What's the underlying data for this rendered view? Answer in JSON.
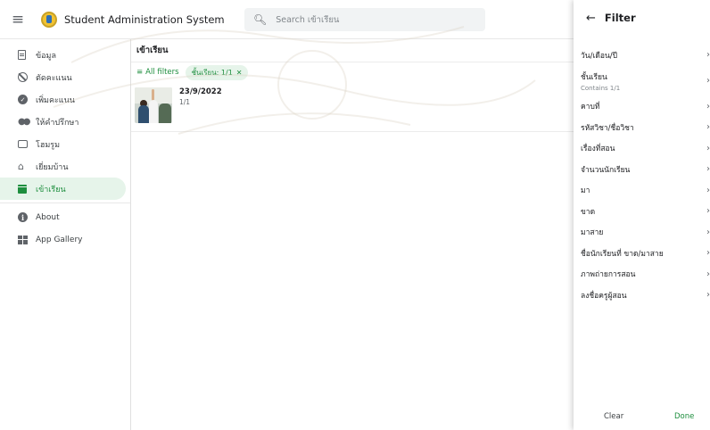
{
  "app": {
    "title": "Student Administration System",
    "search_placeholder": "Search เข้าเรียน"
  },
  "sidebar": {
    "items": [
      {
        "label": "ข้อมูล",
        "icon": "document-icon"
      },
      {
        "label": "ตัดคะแนน",
        "icon": "block-icon"
      },
      {
        "label": "เพิ่มคะแนน",
        "icon": "check-circle-icon"
      },
      {
        "label": "ให้คำปรึกษา",
        "icon": "people-icon"
      },
      {
        "label": "โฮมรูม",
        "icon": "chat-icon"
      },
      {
        "label": "เยี่ยมบ้าน",
        "icon": "home-icon"
      },
      {
        "label": "เข้าเรียน",
        "icon": "calendar-icon",
        "active": true
      }
    ],
    "extra": [
      {
        "label": "About",
        "icon": "info-icon"
      },
      {
        "label": "App Gallery",
        "icon": "grid-icon"
      }
    ]
  },
  "main": {
    "view_title": "เข้าเรียน",
    "all_filters_label": "All filters",
    "chip_label": "ชั้นเรียน: 1/1",
    "record": {
      "date": "23/9/2022",
      "class": "1/1"
    }
  },
  "filter_panel": {
    "title": "Filter",
    "rows": [
      {
        "label": "วัน/เดือน/ปี"
      },
      {
        "label": "ชั้นเรียน",
        "sub": "Contains 1/1"
      },
      {
        "label": "คาบที่"
      },
      {
        "label": "รหัสวิชา/ชื่อวิชา"
      },
      {
        "label": "เรื่องที่สอน"
      },
      {
        "label": "จำนวนนักเรียน"
      },
      {
        "label": "มา"
      },
      {
        "label": "ขาด"
      },
      {
        "label": "มาสาย"
      },
      {
        "label": "ชื่อนักเรียนที่ ขาด/มาสาย"
      },
      {
        "label": "ภาพถ่ายการสอน"
      },
      {
        "label": "ลงชื่อครูผู้สอน"
      }
    ],
    "clear_label": "Clear",
    "done_label": "Done"
  },
  "colors": {
    "accent": "#1e8e3e",
    "accent_bg": "#e6f4ea"
  }
}
